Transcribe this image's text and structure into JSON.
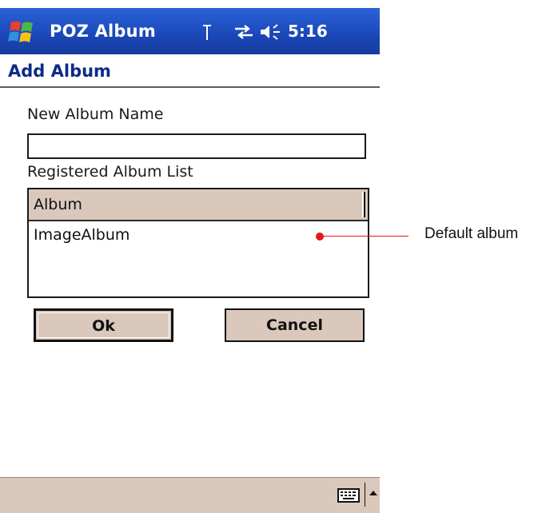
{
  "titlebar": {
    "app_title": "POZ Album",
    "clock": "5:16",
    "icons": [
      "windows-start-icon",
      "antenna-icon",
      "sync-icon",
      "speaker-icon"
    ]
  },
  "page": {
    "title": "Add Album"
  },
  "form": {
    "new_album_label": "New Album Name",
    "new_album_value": "",
    "registered_list_label": "Registered Album List",
    "list_header": "Album",
    "list_items": [
      "ImageAlbum"
    ]
  },
  "buttons": {
    "ok": "Ok",
    "cancel": "Cancel"
  },
  "menubar": {
    "icons": [
      "keyboard-icon",
      "sip-up-arrow-icon"
    ]
  },
  "annotation": {
    "text": "Default album",
    "color": "#e01818"
  },
  "colors": {
    "titlebar": "#1a47b8",
    "page_title": "#0c2a88",
    "control_face": "#dac8bd"
  }
}
